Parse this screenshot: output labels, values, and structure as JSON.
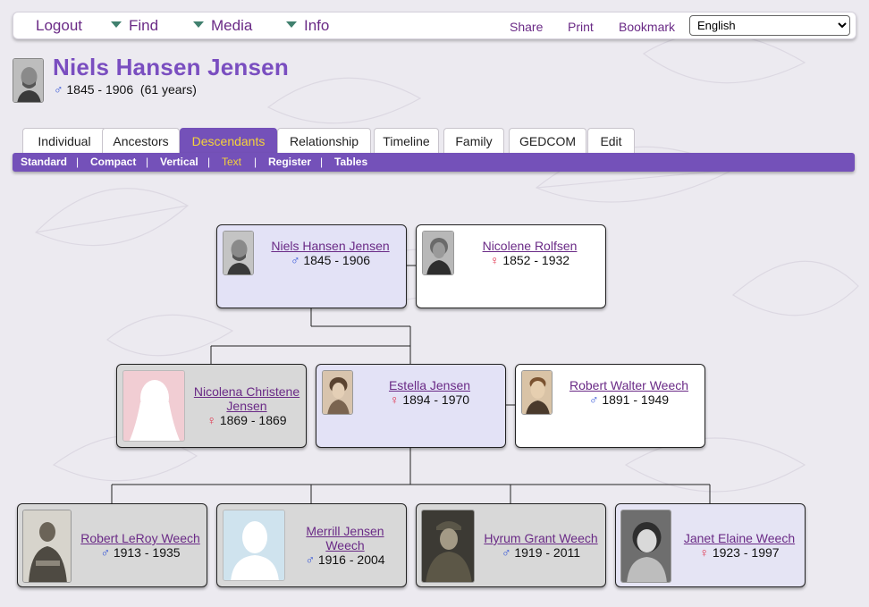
{
  "topbar": {
    "menus": [
      {
        "label": "Logout"
      },
      {
        "label": "Find"
      },
      {
        "label": "Media"
      },
      {
        "label": "Info"
      }
    ],
    "links": [
      "Share",
      "Print",
      "Bookmark"
    ],
    "language": "English"
  },
  "person": {
    "name": "Niels Hansen Jensen",
    "sex_symbol": "♂",
    "dates": "1845 - 1906  (61 years)"
  },
  "tabs": [
    "Individual",
    "Ancestors",
    "Descendants",
    "Relationship",
    "Timeline",
    "Family",
    "GEDCOM",
    "Edit"
  ],
  "active_tab": "Descendants",
  "subtabs": [
    "Standard",
    "Compact",
    "Vertical",
    "Text",
    "Register",
    "Tables"
  ],
  "active_subtab": "Text",
  "chart": {
    "root": {
      "name": "Niels Hansen Jensen",
      "symbol": "♂",
      "dates": "1845 - 1906"
    },
    "root_spouse": {
      "name": "Nicolene Rolfsen",
      "symbol": "♀",
      "dates": "1852 - 1932"
    },
    "children": [
      {
        "name": "Nicolena Christene Jensen",
        "symbol": "♀",
        "dates": "1869 - 1869"
      },
      {
        "name": "Estella Jensen",
        "symbol": "♀",
        "dates": "1894 - 1970"
      }
    ],
    "child_spouse": {
      "name": "Robert Walter Weech",
      "symbol": "♂",
      "dates": "1891 - 1949"
    },
    "grandchildren": [
      {
        "name": "Robert LeRoy Weech",
        "symbol": "♂",
        "dates": "1913 - 1935"
      },
      {
        "name": "Merrill Jensen Weech",
        "symbol": "♂",
        "dates": "1916 - 2004"
      },
      {
        "name": "Hyrum Grant Weech",
        "symbol": "♂",
        "dates": "1919 - 2011"
      },
      {
        "name": "Janet Elaine Weech",
        "symbol": "♀",
        "dates": "1923 - 1997"
      }
    ]
  },
  "colors": {
    "accent_purple": "#7451b9",
    "active_yellow": "#f5d23a",
    "link_purple": "#6a2a86",
    "male_blue": "#2d4fd6",
    "female_red": "#e0304a"
  }
}
